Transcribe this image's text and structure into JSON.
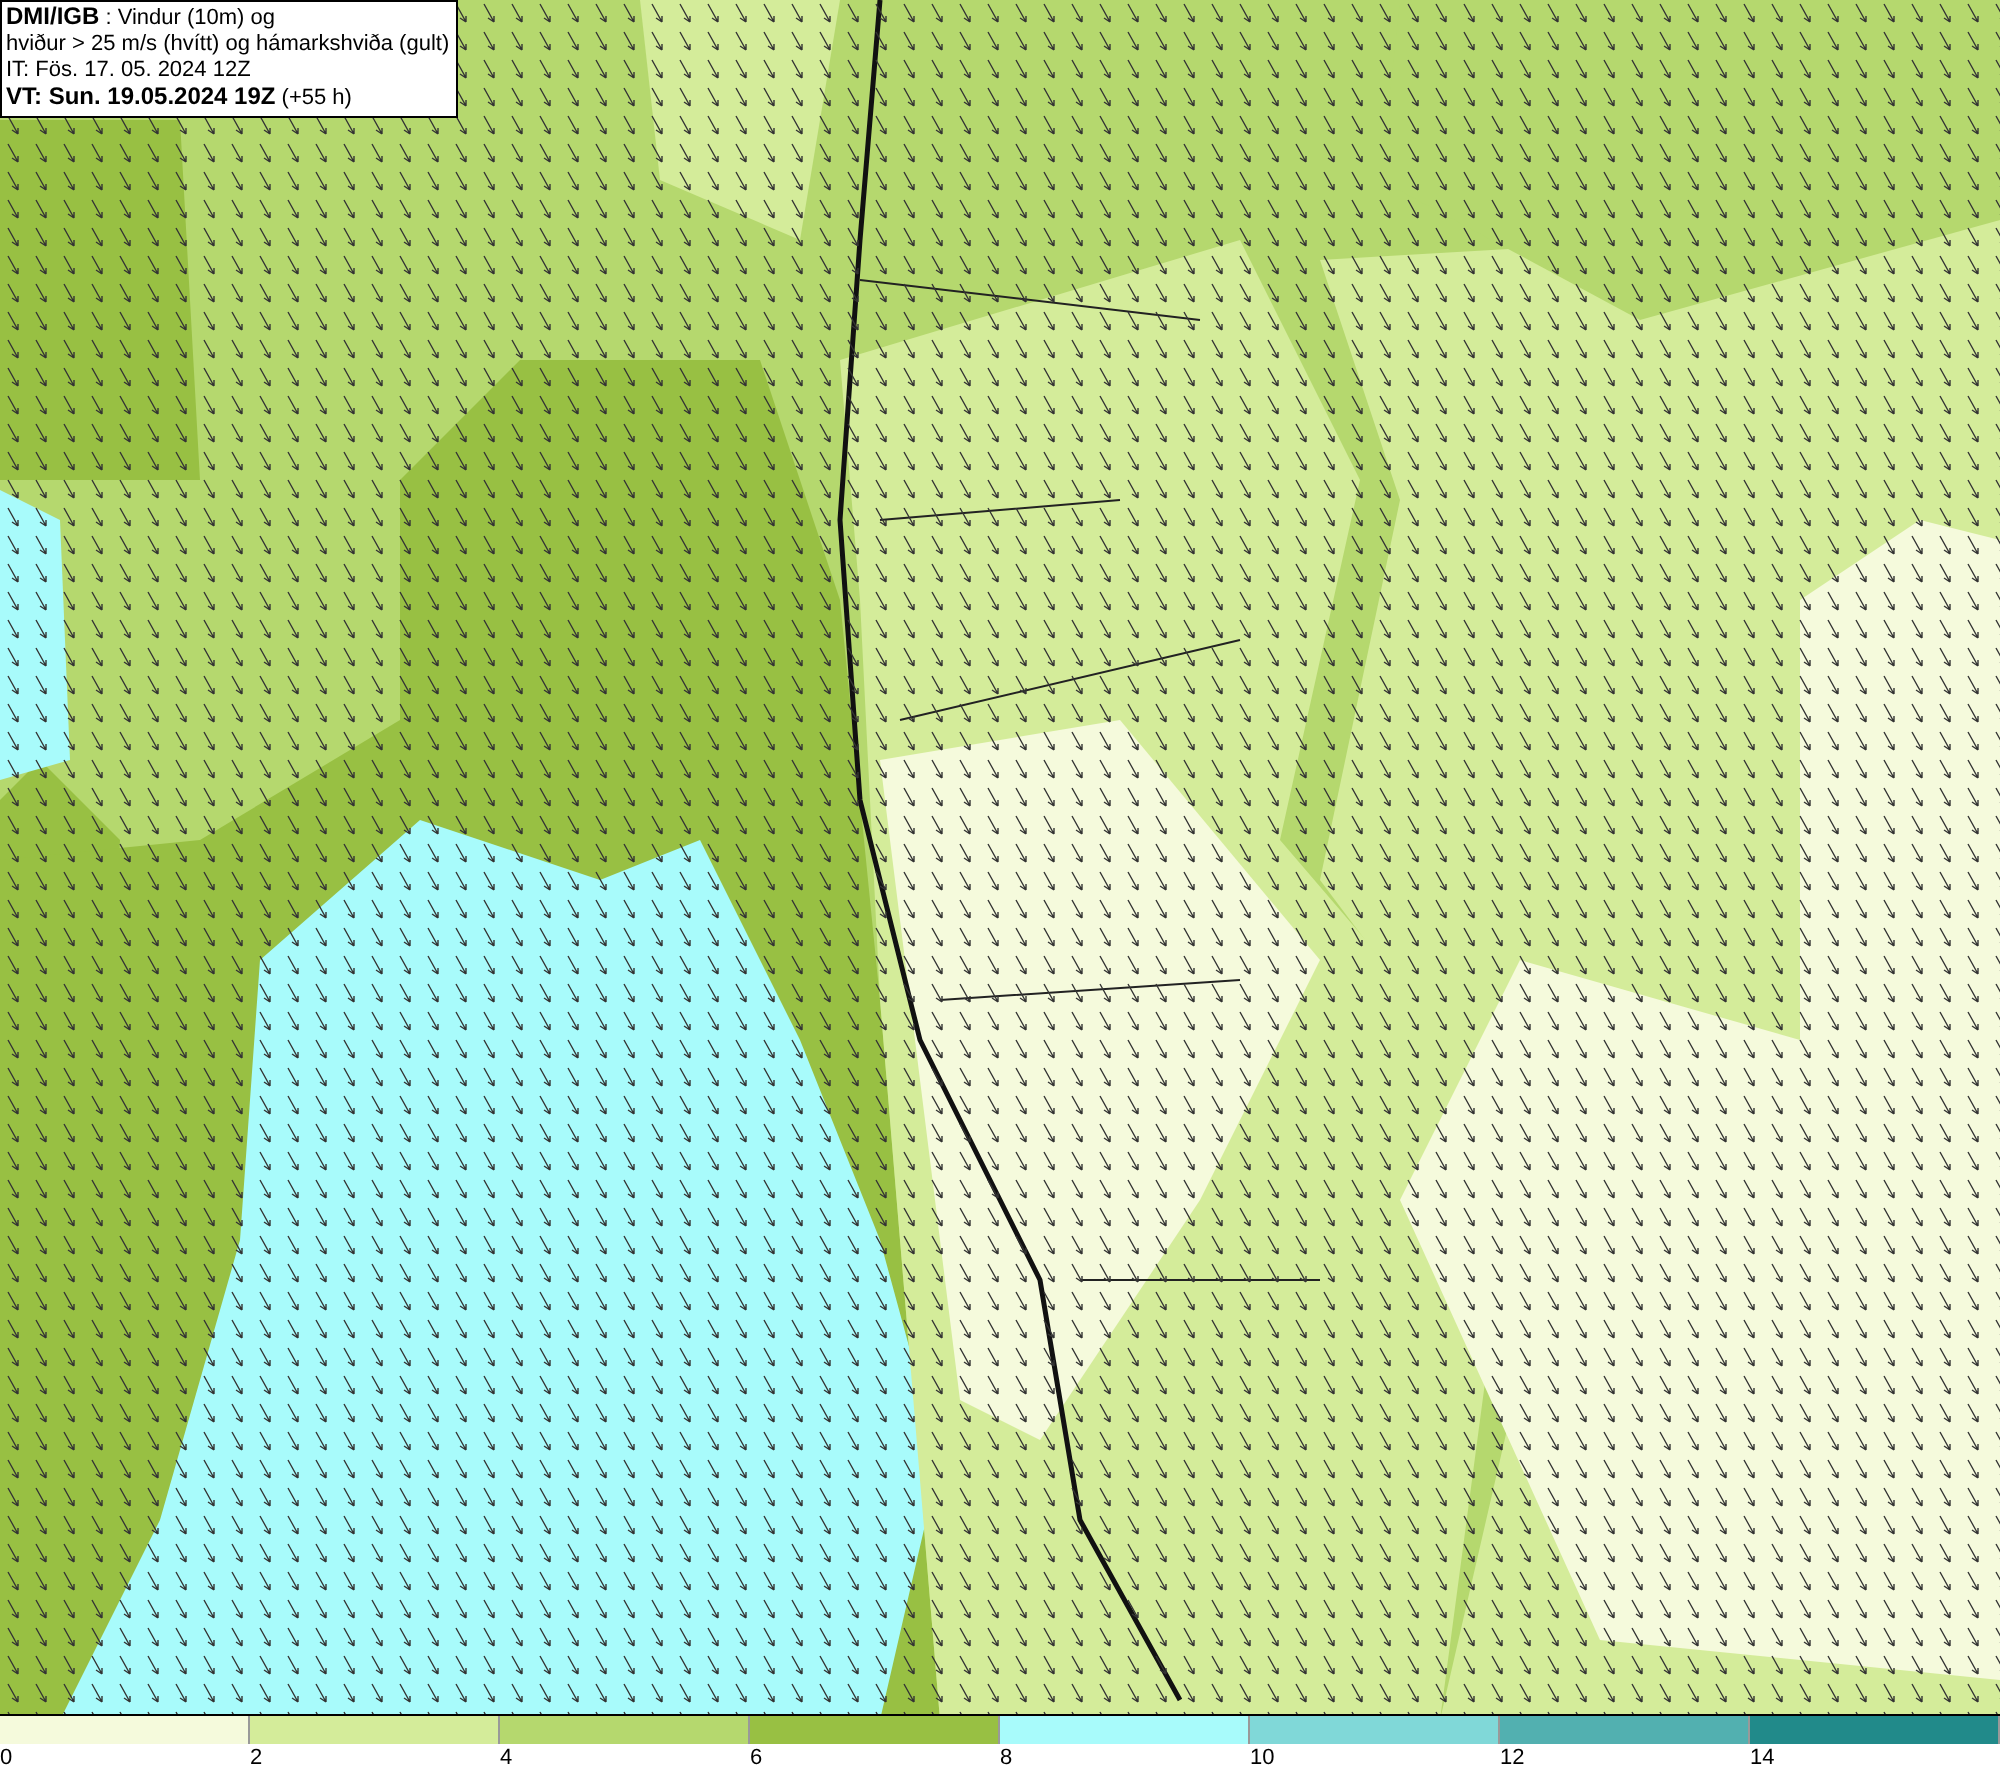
{
  "info_box": {
    "lines": [
      "**DMI/IGB** : Vindur (10m) og",
      "hviður > 25 m/s (hvítt) og hámarkshviða (gult)",
      "IT: Fös. 17. 05. 2024 12Z",
      "**VT: Sun. 19.05.2024 19Z** (+55 h)"
    ]
  },
  "legend": [
    {
      "label": "0",
      "color": "#f5fadc"
    },
    {
      "label": "2",
      "color": "#d4ec9a"
    },
    {
      "label": "4",
      "color": "#b5d86e"
    },
    {
      "label": "6",
      "color": "#98c043"
    },
    {
      "label": "8",
      "color": "#a8fbfb"
    },
    {
      "label": "10",
      "color": "#80d8d8"
    },
    {
      "label": "12",
      "color": "#52b0b0"
    },
    {
      "label": "14",
      "color": "#218a8a"
    }
  ]
}
